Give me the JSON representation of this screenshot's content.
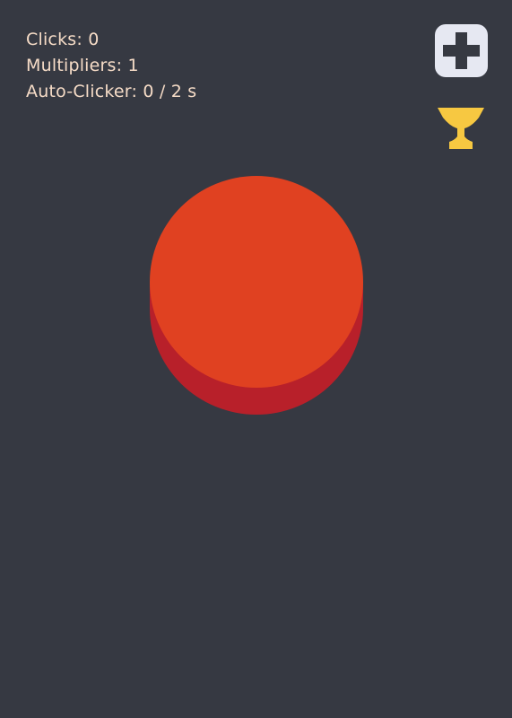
{
  "stats": {
    "clicks": "Clicks: 0",
    "multipliers": "Multipliers: 1",
    "auto_clicker": "Auto-Clicker: 0 / 2 s"
  },
  "icons": {
    "shop": "plus-icon",
    "achievements": "trophy-icon"
  },
  "colors": {
    "background": "#363942",
    "stat_text": "#f6dcc7",
    "button_top": "#e04121",
    "button_side": "#b8202a",
    "trophy": "#f7c841",
    "shop_bg": "#e6e8f2",
    "shop_plus": "#363942"
  }
}
